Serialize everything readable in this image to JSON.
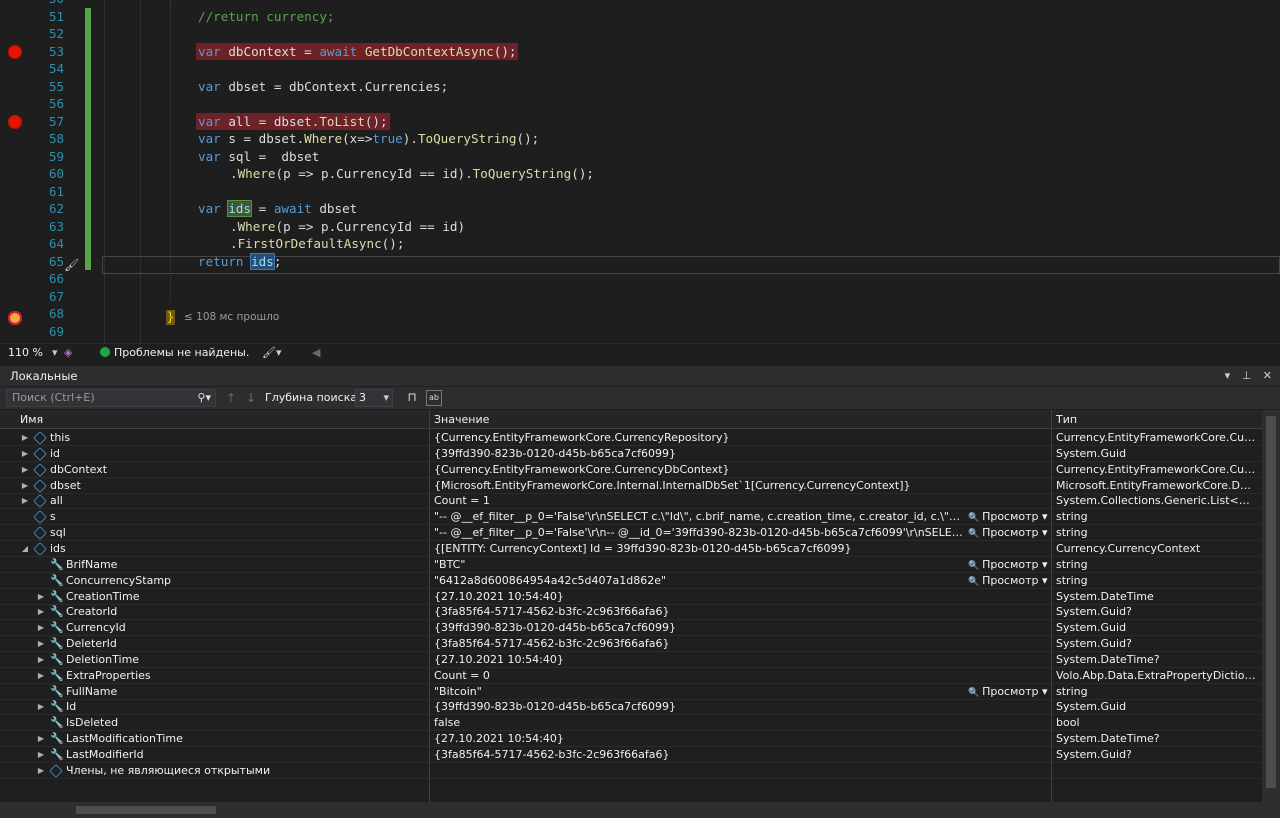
{
  "editor": {
    "lines": [
      {
        "num": "50"
      },
      {
        "num": "51",
        "comment": "//return currency;"
      },
      {
        "num": "52"
      },
      {
        "num": "53",
        "breakpoint": true,
        "kw": "var",
        "rest1": " dbContext = ",
        "kw2": "await",
        "method": " GetDbContextAsync",
        "tail": "();"
      },
      {
        "num": "54"
      },
      {
        "num": "55",
        "kw": "var",
        "rest1": " dbset = dbContext.Currencies;"
      },
      {
        "num": "56"
      },
      {
        "num": "57",
        "breakpoint": true,
        "kw": "var",
        "rest1": " all = dbset.",
        "method": "ToList",
        "tail": "();"
      },
      {
        "num": "58",
        "kw": "var",
        "rest1": " s = dbset.",
        "method": "Where",
        "tail": "(x=>",
        "kw2": "true",
        "tail2": ").",
        "method2": "ToQueryString",
        "tail3": "();"
      },
      {
        "num": "59",
        "kw": "var",
        "rest1": " sql =  dbset"
      },
      {
        "num": "60",
        "rest1": ".",
        "method": "Where",
        "tail": "(p => p.CurrencyId == id).",
        "method2": "ToQueryString",
        "tail3": "();"
      },
      {
        "num": "61"
      },
      {
        "num": "62",
        "kw": "var",
        "hl": "ids",
        "rest1": " = ",
        "kw2": "await",
        "tail": " dbset"
      },
      {
        "num": "63",
        "rest1": ".",
        "method": "Where",
        "tail": "(p => p.CurrencyId == id)"
      },
      {
        "num": "64",
        "rest1": ".",
        "method": "FirstOrDefaultAsync",
        "tail": "();"
      },
      {
        "num": "65",
        "kw": "return",
        "hl2": "ids",
        "tail": ";"
      },
      {
        "num": "66"
      },
      {
        "num": "67"
      },
      {
        "num": "68"
      },
      {
        "num": "69"
      }
    ],
    "elapsed": "≤ 108 мс прошло",
    "brace": "}"
  },
  "status": {
    "zoom": "110 %",
    "problems": "Проблемы не найдены."
  },
  "locals": {
    "title": "Локальные",
    "search_placeholder": "Поиск (Ctrl+E)",
    "depth_label": "Глубина поиска:",
    "depth_value": "3",
    "col_name": "Имя",
    "col_value": "Значение",
    "col_type": "Тип",
    "view_label": "Просмотр",
    "rows": [
      {
        "name": "this",
        "value": "{Currency.EntityFrameworkCore.CurrencyRepository}",
        "type": "Currency.EntityFrameworkCore.CurrencyRepository"
      },
      {
        "name": "id",
        "value": "{39ffd390-823b-0120-d45b-b65ca7cf6099}",
        "type": "System.Guid"
      },
      {
        "name": "dbContext",
        "value": "{Currency.EntityFrameworkCore.CurrencyDbContext}",
        "type": "Currency.EntityFrameworkCore.CurrencyDbContext"
      },
      {
        "name": "dbset",
        "value": "{Microsoft.EntityFrameworkCore.Internal.InternalDbSet`1[Currency.CurrencyContext]}",
        "type": "Microsoft.EntityFrameworkCore.DbSet..."
      },
      {
        "name": "all",
        "value": "Count = 1",
        "type": "System.Collections.Generic.List<Currency..."
      },
      {
        "name": "s",
        "value": "\"-- @__ef_filter__p_0='False'\\r\\nSELECT c.\\\"Id\\\", c.brif_name, c.creation_time, c.creator_id, c.\\\"CurrencyId\\...",
        "type": "string"
      },
      {
        "name": "sql",
        "value": "\"-- @__ef_filter__p_0='False'\\r\\n-- @__id_0='39ffd390-823b-0120-d45b-b65ca7cf6099'\\r\\nSELECT c.\\\"Id\\\", c...",
        "type": "string"
      },
      {
        "name": "ids",
        "value": "{[ENTITY: CurrencyContext] Id = 39ffd390-823b-0120-d45b-b65ca7cf6099}",
        "type": "Currency.CurrencyContext"
      },
      {
        "name": "BrifName",
        "value": "\"BTC\"",
        "type": "string"
      },
      {
        "name": "ConcurrencyStamp",
        "value": "\"6412a8d600864954a42c5d407a1d862e\"",
        "type": "string"
      },
      {
        "name": "CreationTime",
        "value": "{27.10.2021 10:54:40}",
        "type": "System.DateTime"
      },
      {
        "name": "CreatorId",
        "value": "{3fa85f64-5717-4562-b3fc-2c963f66afa6}",
        "type": "System.Guid?"
      },
      {
        "name": "CurrencyId",
        "value": "{39ffd390-823b-0120-d45b-b65ca7cf6099}",
        "type": "System.Guid"
      },
      {
        "name": "DeleterId",
        "value": "{3fa85f64-5717-4562-b3fc-2c963f66afa6}",
        "type": "System.Guid?"
      },
      {
        "name": "DeletionTime",
        "value": "{27.10.2021 10:54:40}",
        "type": "System.DateTime?"
      },
      {
        "name": "ExtraProperties",
        "value": "Count = 0",
        "type": "Volo.Abp.Data.ExtraPropertyDictionary"
      },
      {
        "name": "FullName",
        "value": "\"Bitcoin\"",
        "type": "string"
      },
      {
        "name": "Id",
        "value": "{39ffd390-823b-0120-d45b-b65ca7cf6099}",
        "type": "System.Guid"
      },
      {
        "name": "IsDeleted",
        "value": "false",
        "type": "bool"
      },
      {
        "name": "LastModificationTime",
        "value": "{27.10.2021 10:54:40}",
        "type": "System.DateTime?"
      },
      {
        "name": "LastModifierId",
        "value": "{3fa85f64-5717-4562-b3fc-2c963f66afa6}",
        "type": "System.Guid?"
      },
      {
        "name": "Члены, не являющиеся открытыми",
        "value": "",
        "type": ""
      }
    ]
  }
}
